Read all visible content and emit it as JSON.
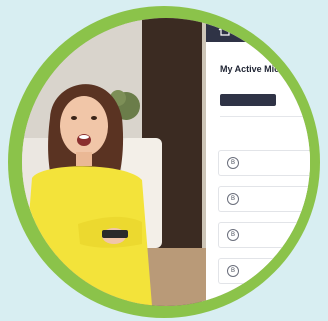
{
  "panel": {
    "breadcrumb": "",
    "title": "My Active Microbes",
    "filter_button": "",
    "cards": [
      {
        "icon": "B",
        "line1": "",
        "line2": ""
      },
      {
        "icon": "B",
        "line1": "",
        "line2": ""
      },
      {
        "icon": "B",
        "line1": "",
        "line2": ""
      },
      {
        "icon": "B",
        "line1": "",
        "line2": ""
      }
    ]
  },
  "colors": {
    "background": "#d8eef2",
    "ring": "#8bc34a",
    "panel_header": "#2f3346",
    "sweater": "#f3e33a"
  }
}
